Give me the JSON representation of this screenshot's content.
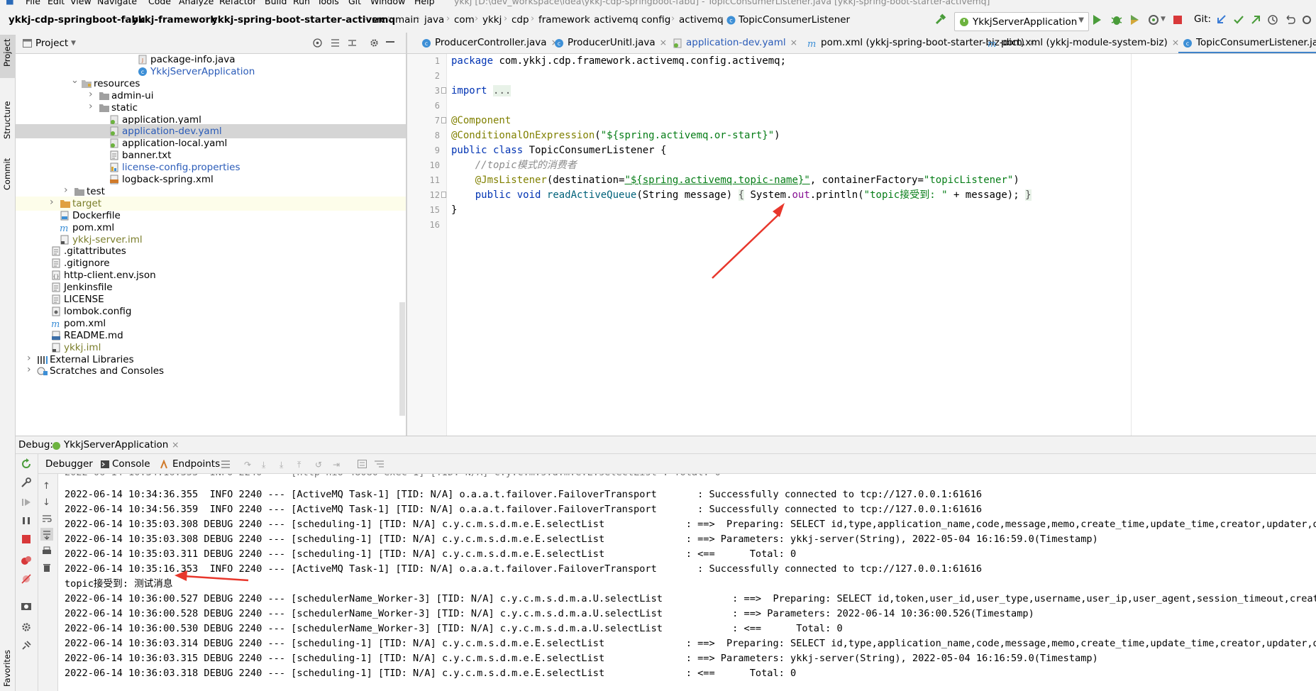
{
  "window": {
    "title": "ykkj [D:\\dev_workspace\\idea\\ykkj-cdp-springboot-fabu] - TopicConsumerListener.java [ykkj-spring-boot-starter-activemq]"
  },
  "menu": [
    "File",
    "Edit",
    "View",
    "Navigate",
    "Code",
    "Analyze",
    "Refactor",
    "Build",
    "Run",
    "Tools",
    "Git",
    "Window",
    "Help"
  ],
  "breadcrumbs": [
    "ykkj-cdp-springboot-fabu",
    "ykkj-framework",
    "ykkj-spring-boot-starter-activemq",
    "src",
    "main",
    "java",
    "com",
    "ykkj",
    "cdp",
    "framework",
    "activemq",
    "config",
    "activemq",
    "TopicConsumerListener"
  ],
  "toolbar": {
    "run_config": "YkkjServerApplication",
    "git_label": "Git:"
  },
  "left_strip": {
    "project": "Project",
    "structure": "Structure",
    "commit": "Commit",
    "favorites": "Favorites"
  },
  "project_panel": {
    "title": "Project",
    "tree": [
      {
        "label": "package-info.java",
        "icon": "java-file-icon",
        "color": "#000000"
      },
      {
        "label": "YkkjServerApplication",
        "icon": "class-icon",
        "color": "#2a5bb8"
      },
      {
        "label": "resources",
        "icon": "resources-folder-icon",
        "color": "#000000",
        "arrow": "down"
      },
      {
        "label": "admin-ui",
        "icon": "folder-icon",
        "color": "#000000",
        "arrow": "right"
      },
      {
        "label": "static",
        "icon": "folder-icon",
        "color": "#000000",
        "arrow": "right"
      },
      {
        "label": "application.yaml",
        "icon": "yaml-file-icon",
        "color": "#000000"
      },
      {
        "label": "application-dev.yaml",
        "icon": "yaml-file-icon",
        "color": "#2a5bb8",
        "selected": true
      },
      {
        "label": "application-local.yaml",
        "icon": "yaml-file-icon",
        "color": "#000000"
      },
      {
        "label": "banner.txt",
        "icon": "text-file-icon",
        "color": "#000000"
      },
      {
        "label": "license-config.properties",
        "icon": "properties-file-icon",
        "color": "#2a5bb8"
      },
      {
        "label": "logback-spring.xml",
        "icon": "xml-file-icon",
        "color": "#000000"
      },
      {
        "label": "test",
        "icon": "folder-icon",
        "color": "#000000",
        "arrow": "right"
      },
      {
        "label": "target",
        "icon": "excluded-folder-icon",
        "color": "#7a7d2a",
        "arrow": "right",
        "highlighted": true
      },
      {
        "label": "Dockerfile",
        "icon": "docker-file-icon",
        "color": "#000000"
      },
      {
        "label": "pom.xml",
        "icon": "maven-icon",
        "color": "#000000"
      },
      {
        "label": "ykkj-server.iml",
        "icon": "iml-file-icon",
        "color": "#7a7d2a"
      },
      {
        "label": ".gitattributes",
        "icon": "text-file-icon",
        "color": "#000000"
      },
      {
        "label": ".gitignore",
        "icon": "text-file-icon",
        "color": "#000000"
      },
      {
        "label": "http-client.env.json",
        "icon": "json-file-icon",
        "color": "#000000"
      },
      {
        "label": "Jenkinsfile",
        "icon": "text-file-icon",
        "color": "#000000"
      },
      {
        "label": "LICENSE",
        "icon": "text-file-icon",
        "color": "#000000"
      },
      {
        "label": "lombok.config",
        "icon": "config-file-icon",
        "color": "#000000"
      },
      {
        "label": "pom.xml",
        "icon": "maven-icon",
        "color": "#000000"
      },
      {
        "label": "README.md",
        "icon": "markdown-file-icon",
        "color": "#000000"
      },
      {
        "label": "ykkj.iml",
        "icon": "iml-file-icon",
        "color": "#7a7d2a"
      },
      {
        "label": "External Libraries",
        "icon": "library-icon",
        "color": "#000000",
        "arrow": "right"
      },
      {
        "label": "Scratches and Consoles",
        "icon": "scratches-icon",
        "color": "#000000",
        "arrow": "right"
      }
    ]
  },
  "editor_tabs": [
    {
      "label": "ProducerController.java",
      "color": "#000000"
    },
    {
      "label": "ProducerUnitl.java",
      "color": "#000000"
    },
    {
      "label": "application-dev.yaml",
      "color": "#2a5bb8"
    },
    {
      "label": "pom.xml (ykkj-spring-boot-starter-biz-dict)",
      "color": "#000000"
    },
    {
      "label": "pom.xml (ykkj-module-system-biz)",
      "color": "#000000"
    },
    {
      "label": "TopicConsumerListener.java",
      "color": "#000000",
      "active": true
    }
  ],
  "code": {
    "line_numbers": [
      "1",
      "2",
      "3",
      "6",
      "7",
      "8",
      "9",
      "10",
      "11",
      "12",
      "15",
      "16"
    ],
    "package_kw": "package",
    "package_name": " com.ykkj.cdp.framework.activemq.config.activemq;",
    "import_kw": "import",
    "import_fold": "...",
    "ann_component": "@Component",
    "ann_conditional": "@ConditionalOnExpression",
    "conditional_arg": "\"${spring.activemq.or-start}\"",
    "public_kw": "public",
    "class_kw": "class",
    "class_name": "TopicConsumerListener",
    "comment": "//topic模式的消费者",
    "ann_jms": "@JmsListener",
    "jms_dest_prefix": "(destination=",
    "jms_dest_value": "\"${spring.activemq.topic-name}\"",
    "jms_container": ", containerFactory=",
    "jms_container_value": "\"topicListener\"",
    "void_kw": "void",
    "method_name": "readActiveQueue",
    "method_params": "(String message) ",
    "body_open": "{",
    "body_system": " System.",
    "body_out": "out",
    "body_println": ".println(",
    "body_string": "\"topic接受到: \"",
    "body_rest": " + message); ",
    "body_close": "}",
    "close_brace": "}",
    "open_brace": " {",
    "semicolon_paren": ")",
    "paren_open": "(",
    "paren_close": ")"
  },
  "debug": {
    "title": "Debug:",
    "session_tab": "YkkjServerApplication",
    "tabs": [
      "Debugger",
      "Console",
      "Endpoints"
    ]
  },
  "console_lines": [
    "2022-06-14 10:34:36.355  INFO 2240 --- [ActiveMQ Task-1] [TID: N/A] o.a.a.t.failover.FailoverTransport       : Successfully connected to tcp://127.0.0.1:61616",
    "2022-06-14 10:34:56.359  INFO 2240 --- [ActiveMQ Task-1] [TID: N/A] o.a.a.t.failover.FailoverTransport       : Successfully connected to tcp://127.0.0.1:61616",
    "2022-06-14 10:35:03.308 DEBUG 2240 --- [scheduling-1] [TID: N/A] c.y.c.m.s.d.m.e.E.selectList              : ==>  Preparing: SELECT id,type,application_name,code,message,memo,create_time,update_time,creator,updater,deleted",
    "2022-06-14 10:35:03.308 DEBUG 2240 --- [scheduling-1] [TID: N/A] c.y.c.m.s.d.m.e.E.selectList              : ==> Parameters: ykkj-server(String), 2022-05-04 16:16:59.0(Timestamp)",
    "2022-06-14 10:35:03.311 DEBUG 2240 --- [scheduling-1] [TID: N/A] c.y.c.m.s.d.m.e.E.selectList              : <==      Total: 0",
    "2022-06-14 10:35:16.353  INFO 2240 --- [ActiveMQ Task-1] [TID: N/A] o.a.a.t.failover.FailoverTransport       : Successfully connected to tcp://127.0.0.1:61616",
    "topic接受到: 测试消息",
    "2022-06-14 10:36:00.527 DEBUG 2240 --- [schedulerName_Worker-3] [TID: N/A] c.y.c.m.s.d.m.a.U.selectList            : ==>  Preparing: SELECT id,token,user_id,user_type,username,user_ip,user_agent,session_timeout,create_ti",
    "2022-06-14 10:36:00.528 DEBUG 2240 --- [schedulerName_Worker-3] [TID: N/A] c.y.c.m.s.d.m.a.U.selectList            : ==> Parameters: 2022-06-14 10:36:00.526(Timestamp)",
    "2022-06-14 10:36:00.530 DEBUG 2240 --- [schedulerName_Worker-3] [TID: N/A] c.y.c.m.s.d.m.a.U.selectList            : <==      Total: 0",
    "2022-06-14 10:36:03.314 DEBUG 2240 --- [scheduling-1] [TID: N/A] c.y.c.m.s.d.m.e.E.selectList              : ==>  Preparing: SELECT id,type,application_name,code,message,memo,create_time,update_time,creator,updater,deleted",
    "2022-06-14 10:36:03.315 DEBUG 2240 --- [scheduling-1] [TID: N/A] c.y.c.m.s.d.m.e.E.selectList              : ==> Parameters: ykkj-server(String), 2022-05-04 16:16:59.0(Timestamp)",
    "2022-06-14 10:36:03.318 DEBUG 2240 --- [scheduling-1] [TID: N/A] c.y.c.m.s.d.m.e.E.selectList              : <==      Total: 0"
  ],
  "colors": {
    "accent": "#4083c9",
    "arrow_annotation": "#e8372c",
    "keyword": "#0033b3",
    "string": "#067d17",
    "annotation": "#808000"
  }
}
